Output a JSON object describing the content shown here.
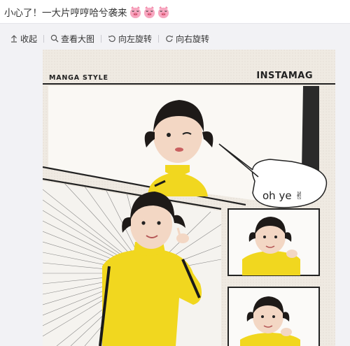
{
  "post": {
    "text": "小心了！一大片哼哼哈兮袭来",
    "emoji_icons": [
      "pig-face-icon",
      "pig-face-icon",
      "pig-face-icon"
    ]
  },
  "toolbar": {
    "collapse_label": "收起",
    "view_large_label": "查看大图",
    "rotate_left_label": "向左旋转",
    "rotate_right_label": "向右旋转"
  },
  "photo": {
    "header_left": "MANGA STYLE",
    "header_right": "INSTAMAG",
    "bubble_text": "oh ye ✌"
  },
  "colors": {
    "accent_yellow": "#f1d71f",
    "ink": "#1a1a1a",
    "skin": "#f3d7c4",
    "paper": "#f7f4ee",
    "toolbar_bg": "#f2f2f5"
  }
}
